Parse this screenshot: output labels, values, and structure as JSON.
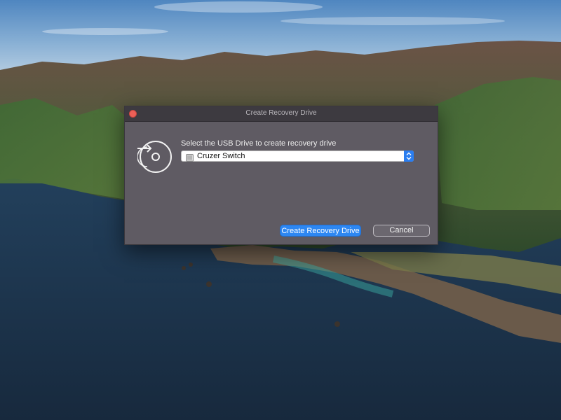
{
  "window": {
    "title": "Create Recovery Drive"
  },
  "dialog": {
    "prompt": "Select the USB Drive to create recovery drive",
    "selected_drive": "Cruzer Switch"
  },
  "buttons": {
    "create_label": "Create Recovery Drive",
    "cancel_label": "Cancel"
  },
  "icons": {
    "close": "close-icon",
    "recovery": "disc-arrow-icon",
    "drive": "hard-drive-icon",
    "stepper": "chevron-updown-icon"
  },
  "colors": {
    "accent": "#2d87f2",
    "close": "#ec5f57",
    "window_bg": "#5f5b63",
    "titlebar_bg": "#3d3a40"
  }
}
